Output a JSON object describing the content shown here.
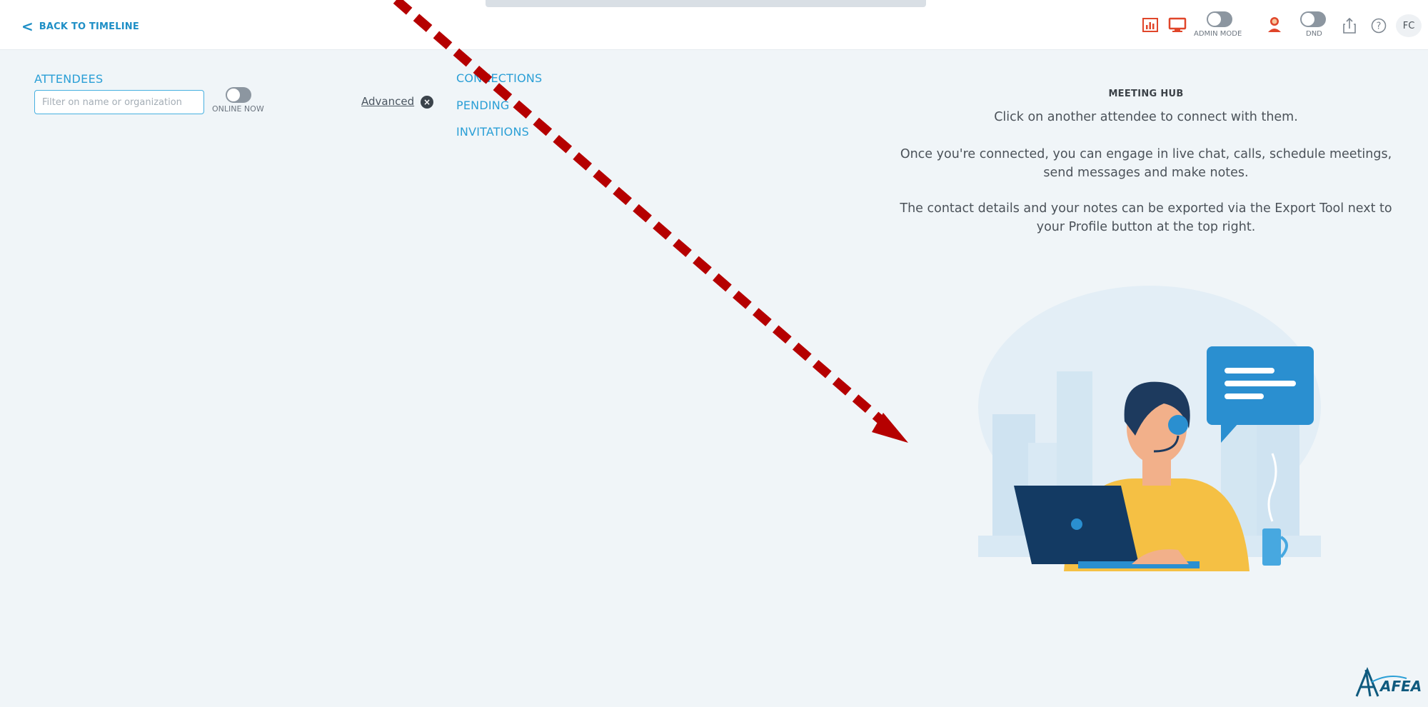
{
  "topbar": {
    "back_label": "BACK TO TIMELINE",
    "admin_mode_label": "ADMIN MODE",
    "dnd_label": "DND",
    "user_initials": "FC"
  },
  "attendees": {
    "title": "ATTENDEES",
    "filter_placeholder": "Filter on name or organization",
    "online_now_label": "ONLINE NOW",
    "advanced_label": "Advanced"
  },
  "nav": {
    "connections": "CONNECTIONS",
    "pending": "PENDING",
    "invitations": "INVITATIONS"
  },
  "hub": {
    "title": "MEETING HUB",
    "line1": "Click on another attendee to connect with them.",
    "line2": "Once you're connected, you can engage in live chat, calls, schedule meetings, send messages and make notes.",
    "line3": "The contact details and your notes can be exported via the Export Tool next to your Profile button at the top right."
  },
  "colors": {
    "accent": "#2a9fd6",
    "icon_red": "#e0462a",
    "arrow": "#b50000"
  }
}
